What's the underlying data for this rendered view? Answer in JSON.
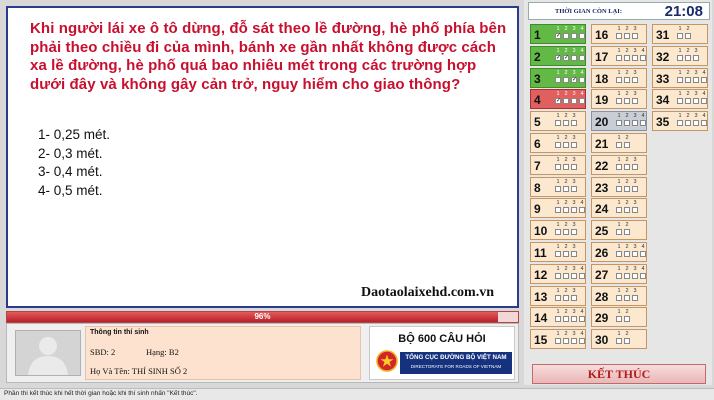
{
  "question": {
    "text": "Khi người lái xe ô tô dừng, đỗ sát theo lề đường, hè phố phía bên phải theo chiều đi của mình, bánh xe gần nhất không được cách xa lề đường, hè phố quá bao nhiêu mét trong các trường hợp dưới đây và không gây cản trở, nguy hiểm cho giao thông?",
    "answers": [
      "1- 0,25 mét.",
      "2- 0,3 mét.",
      "3- 0,4 mét.",
      "4- 0,5 mét."
    ],
    "watermark": "Daotaolaixehd.com.vn"
  },
  "progress": {
    "percent": 96,
    "label": "96%"
  },
  "candidate": {
    "title": "Thông tin thí sinh",
    "sbd": "SBD: 2",
    "hang": "Hạng: B2",
    "name": "Họ Và Tên: THÍ SINH SỐ 2"
  },
  "exam": {
    "title": "BỘ 600 CÂU HỎI",
    "department": "TỔNG CỤC ĐƯỜNG BỘ VIỆT NAM",
    "department_en": "DIRECTORATE FOR ROADS OF VIETNAM"
  },
  "timer": {
    "label": "THỜI GIAN CÒN LẠI:",
    "value": "21:08"
  },
  "questions": [
    {
      "n": "1",
      "opts": [
        "1",
        "2",
        "3",
        "4"
      ],
      "checked": [
        "✓",
        "",
        "",
        ""
      ],
      "state": "answered"
    },
    {
      "n": "2",
      "opts": [
        "1",
        "2",
        "3",
        "4"
      ],
      "checked": [
        "✓",
        "✓",
        "",
        ""
      ],
      "state": "answered"
    },
    {
      "n": "3",
      "opts": [
        "1",
        "2",
        "3",
        "4"
      ],
      "checked": [
        "",
        "",
        "✓",
        ""
      ],
      "state": "answered"
    },
    {
      "n": "4",
      "opts": [
        "1",
        "2",
        "3",
        "4"
      ],
      "checked": [
        "✓",
        "",
        "",
        ""
      ],
      "state": "wrong"
    },
    {
      "n": "5",
      "opts": [
        "1",
        "2",
        "3"
      ],
      "checked": [
        "",
        "",
        ""
      ],
      "state": "normal"
    },
    {
      "n": "6",
      "opts": [
        "1",
        "2",
        "3"
      ],
      "checked": [
        "",
        "",
        ""
      ],
      "state": "normal"
    },
    {
      "n": "7",
      "opts": [
        "1",
        "2",
        "3"
      ],
      "checked": [
        "",
        "",
        ""
      ],
      "state": "normal"
    },
    {
      "n": "8",
      "opts": [
        "1",
        "2",
        "3"
      ],
      "checked": [
        "",
        "",
        ""
      ],
      "state": "normal"
    },
    {
      "n": "9",
      "opts": [
        "1",
        "2",
        "3",
        "4"
      ],
      "checked": [
        "",
        "",
        "",
        ""
      ],
      "state": "normal"
    },
    {
      "n": "10",
      "opts": [
        "1",
        "2",
        "3"
      ],
      "checked": [
        "",
        "",
        ""
      ],
      "state": "normal"
    },
    {
      "n": "11",
      "opts": [
        "1",
        "2",
        "3"
      ],
      "checked": [
        "",
        "",
        ""
      ],
      "state": "normal"
    },
    {
      "n": "12",
      "opts": [
        "1",
        "2",
        "3",
        "4"
      ],
      "checked": [
        "",
        "",
        "",
        ""
      ],
      "state": "normal"
    },
    {
      "n": "13",
      "opts": [
        "1",
        "2",
        "3"
      ],
      "checked": [
        "",
        "",
        ""
      ],
      "state": "normal"
    },
    {
      "n": "14",
      "opts": [
        "1",
        "2",
        "3",
        "4"
      ],
      "checked": [
        "",
        "",
        "",
        ""
      ],
      "state": "normal"
    },
    {
      "n": "15",
      "opts": [
        "1",
        "2",
        "3",
        "4"
      ],
      "checked": [
        "",
        "",
        "",
        ""
      ],
      "state": "normal"
    },
    {
      "n": "16",
      "opts": [
        "1",
        "2",
        "3"
      ],
      "checked": [
        "",
        "",
        ""
      ],
      "state": "normal"
    },
    {
      "n": "17",
      "opts": [
        "1",
        "2",
        "3",
        "4"
      ],
      "checked": [
        "",
        "",
        "",
        ""
      ],
      "state": "normal"
    },
    {
      "n": "18",
      "opts": [
        "1",
        "2",
        "3"
      ],
      "checked": [
        "",
        "",
        ""
      ],
      "state": "normal"
    },
    {
      "n": "19",
      "opts": [
        "1",
        "2",
        "3"
      ],
      "checked": [
        "",
        "",
        ""
      ],
      "state": "normal"
    },
    {
      "n": "20",
      "opts": [
        "1",
        "2",
        "3",
        "4"
      ],
      "checked": [
        "",
        "",
        "",
        ""
      ],
      "state": "current"
    },
    {
      "n": "21",
      "opts": [
        "1",
        "2"
      ],
      "checked": [
        "",
        ""
      ],
      "state": "normal"
    },
    {
      "n": "22",
      "opts": [
        "1",
        "2",
        "3"
      ],
      "checked": [
        "",
        "",
        ""
      ],
      "state": "normal"
    },
    {
      "n": "23",
      "opts": [
        "1",
        "2",
        "3"
      ],
      "checked": [
        "",
        "",
        ""
      ],
      "state": "normal"
    },
    {
      "n": "24",
      "opts": [
        "1",
        "2",
        "3"
      ],
      "checked": [
        "",
        "",
        ""
      ],
      "state": "normal"
    },
    {
      "n": "25",
      "opts": [
        "1",
        "2"
      ],
      "checked": [
        "",
        ""
      ],
      "state": "normal"
    },
    {
      "n": "26",
      "opts": [
        "1",
        "2",
        "3",
        "4"
      ],
      "checked": [
        "",
        "",
        "",
        ""
      ],
      "state": "normal"
    },
    {
      "n": "27",
      "opts": [
        "1",
        "2",
        "3",
        "4"
      ],
      "checked": [
        "",
        "",
        "",
        ""
      ],
      "state": "normal"
    },
    {
      "n": "28",
      "opts": [
        "1",
        "2",
        "3"
      ],
      "checked": [
        "",
        "",
        ""
      ],
      "state": "normal"
    },
    {
      "n": "29",
      "opts": [
        "1",
        "2"
      ],
      "checked": [
        "",
        ""
      ],
      "state": "normal"
    },
    {
      "n": "30",
      "opts": [
        "1",
        "2"
      ],
      "checked": [
        "",
        ""
      ],
      "state": "normal"
    },
    {
      "n": "31",
      "opts": [
        "1",
        "2"
      ],
      "checked": [
        "",
        ""
      ],
      "state": "normal"
    },
    {
      "n": "32",
      "opts": [
        "1",
        "2",
        "3"
      ],
      "checked": [
        "",
        "",
        ""
      ],
      "state": "normal"
    },
    {
      "n": "33",
      "opts": [
        "1",
        "2",
        "3",
        "4"
      ],
      "checked": [
        "",
        "",
        "",
        ""
      ],
      "state": "normal"
    },
    {
      "n": "34",
      "opts": [
        "1",
        "2",
        "3",
        "4"
      ],
      "checked": [
        "",
        "",
        "",
        ""
      ],
      "state": "normal"
    },
    {
      "n": "35",
      "opts": [
        "1",
        "2",
        "3",
        "4"
      ],
      "checked": [
        "",
        "",
        "",
        ""
      ],
      "state": "normal"
    }
  ],
  "finish_label": "KẾT THÚC",
  "status_text": "Phần thi kết thúc khi hết thời gian hoặc khi thí sinh nhấn \"Kết thúc\".",
  "colors": {
    "question_text": "#c8102e",
    "frame": "#2b3a8a",
    "answered": "#62b946",
    "wrong": "#e06060",
    "normal": "#fbe8cf",
    "department_bar": "#16327e"
  },
  "icons": {
    "avatar": "person-silhouette-icon",
    "emblem": "vietnam-emblem-icon"
  }
}
